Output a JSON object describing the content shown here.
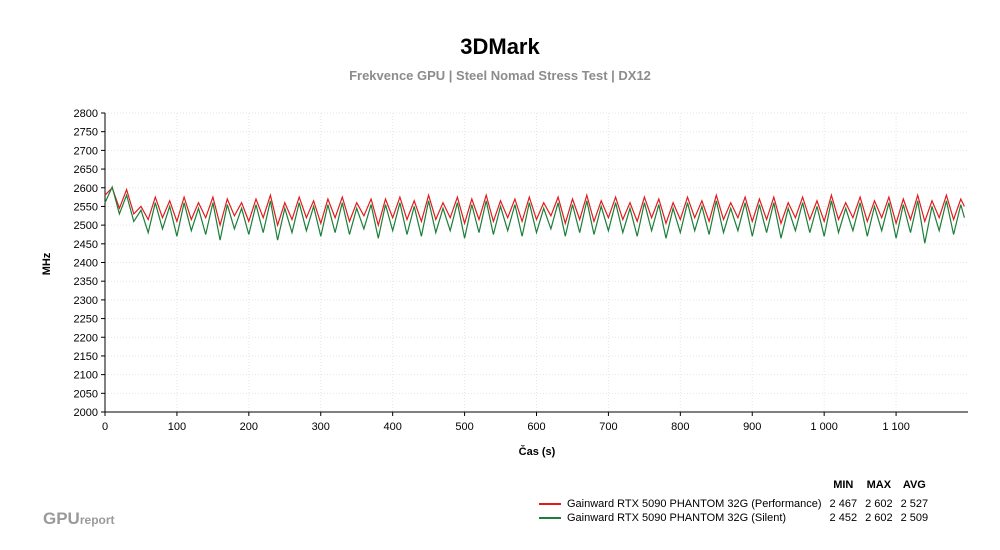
{
  "chart_data": {
    "type": "line",
    "title": "3DMark",
    "subtitle": "Frekvence GPU | Steel Nomad Stress Test | DX12",
    "xlabel": "Čas (s)",
    "ylabel": "MHz",
    "xlim": [
      0,
      1200
    ],
    "ylim": [
      2000,
      2800
    ],
    "x_ticks": [
      0,
      100,
      200,
      300,
      400,
      500,
      600,
      700,
      800,
      900,
      1000,
      1100
    ],
    "x_tick_labels": [
      "0",
      "100",
      "200",
      "300",
      "400",
      "500",
      "600",
      "700",
      "800",
      "900",
      "1 000",
      "1 100"
    ],
    "y_ticks": [
      2000,
      2050,
      2100,
      2150,
      2200,
      2250,
      2300,
      2350,
      2400,
      2450,
      2500,
      2550,
      2600,
      2650,
      2700,
      2750,
      2800
    ],
    "grid": true,
    "legend_headers": [
      "MIN",
      "MAX",
      "AVG"
    ],
    "series": [
      {
        "name": "Gainward RTX 5090 PHANTOM 32G (Performance)",
        "color": "#e31a1c",
        "min": "2 467",
        "max": "2 602",
        "avg": "2 527",
        "x": [
          0,
          10,
          20,
          30,
          40,
          50,
          60,
          70,
          80,
          90,
          100,
          110,
          120,
          130,
          140,
          150,
          160,
          170,
          180,
          190,
          200,
          210,
          220,
          230,
          240,
          250,
          260,
          270,
          280,
          290,
          300,
          310,
          320,
          330,
          340,
          350,
          360,
          370,
          380,
          390,
          400,
          410,
          420,
          430,
          440,
          450,
          460,
          470,
          480,
          490,
          500,
          510,
          520,
          530,
          540,
          550,
          560,
          570,
          580,
          590,
          600,
          610,
          620,
          630,
          640,
          650,
          660,
          670,
          680,
          690,
          700,
          710,
          720,
          730,
          740,
          750,
          760,
          770,
          780,
          790,
          800,
          810,
          820,
          830,
          840,
          850,
          860,
          870,
          880,
          890,
          900,
          910,
          920,
          930,
          940,
          950,
          960,
          970,
          980,
          990,
          1000,
          1010,
          1020,
          1030,
          1040,
          1050,
          1060,
          1070,
          1080,
          1090,
          1100,
          1110,
          1120,
          1130,
          1140,
          1150,
          1160,
          1170,
          1180,
          1190,
          1195
        ],
        "y": [
          2580,
          2600,
          2545,
          2595,
          2530,
          2550,
          2515,
          2575,
          2520,
          2565,
          2510,
          2575,
          2515,
          2560,
          2520,
          2575,
          2500,
          2570,
          2525,
          2560,
          2510,
          2570,
          2520,
          2580,
          2500,
          2560,
          2515,
          2575,
          2520,
          2565,
          2505,
          2570,
          2520,
          2575,
          2510,
          2560,
          2525,
          2570,
          2500,
          2570,
          2520,
          2575,
          2515,
          2565,
          2510,
          2580,
          2515,
          2560,
          2520,
          2575,
          2505,
          2570,
          2515,
          2580,
          2510,
          2565,
          2520,
          2570,
          2510,
          2575,
          2515,
          2560,
          2525,
          2575,
          2505,
          2570,
          2515,
          2580,
          2510,
          2565,
          2520,
          2575,
          2515,
          2560,
          2510,
          2575,
          2520,
          2570,
          2505,
          2560,
          2515,
          2575,
          2520,
          2565,
          2510,
          2580,
          2515,
          2560,
          2520,
          2575,
          2510,
          2570,
          2515,
          2575,
          2505,
          2560,
          2520,
          2575,
          2515,
          2565,
          2510,
          2580,
          2515,
          2560,
          2520,
          2575,
          2510,
          2565,
          2520,
          2575,
          2505,
          2570,
          2515,
          2580,
          2510,
          2565,
          2520,
          2580,
          2515,
          2570,
          2550
        ]
      },
      {
        "name": "Gainward RTX 5090 PHANTOM 32G (Silent)",
        "color": "#1b7f3a",
        "min": "2 452",
        "max": "2 602",
        "avg": "2 509",
        "x": [
          0,
          10,
          20,
          30,
          40,
          50,
          60,
          70,
          80,
          90,
          100,
          110,
          120,
          130,
          140,
          150,
          160,
          170,
          180,
          190,
          200,
          210,
          220,
          230,
          240,
          250,
          260,
          270,
          280,
          290,
          300,
          310,
          320,
          330,
          340,
          350,
          360,
          370,
          380,
          390,
          400,
          410,
          420,
          430,
          440,
          450,
          460,
          470,
          480,
          490,
          500,
          510,
          520,
          530,
          540,
          550,
          560,
          570,
          580,
          590,
          600,
          610,
          620,
          630,
          640,
          650,
          660,
          670,
          680,
          690,
          700,
          710,
          720,
          730,
          740,
          750,
          760,
          770,
          780,
          790,
          800,
          810,
          820,
          830,
          840,
          850,
          860,
          870,
          880,
          890,
          900,
          910,
          920,
          930,
          940,
          950,
          960,
          970,
          980,
          990,
          1000,
          1010,
          1020,
          1030,
          1040,
          1050,
          1060,
          1070,
          1080,
          1090,
          1100,
          1110,
          1120,
          1130,
          1140,
          1150,
          1160,
          1170,
          1180,
          1190,
          1195
        ],
        "y": [
          2560,
          2602,
          2530,
          2580,
          2510,
          2540,
          2480,
          2560,
          2490,
          2550,
          2470,
          2560,
          2485,
          2545,
          2475,
          2560,
          2460,
          2555,
          2490,
          2545,
          2475,
          2555,
          2480,
          2565,
          2460,
          2545,
          2480,
          2560,
          2485,
          2550,
          2470,
          2555,
          2480,
          2560,
          2475,
          2545,
          2490,
          2555,
          2465,
          2555,
          2485,
          2560,
          2475,
          2550,
          2470,
          2565,
          2480,
          2545,
          2485,
          2560,
          2465,
          2555,
          2480,
          2565,
          2475,
          2550,
          2485,
          2555,
          2470,
          2560,
          2480,
          2545,
          2490,
          2560,
          2470,
          2555,
          2480,
          2565,
          2475,
          2550,
          2485,
          2560,
          2480,
          2545,
          2470,
          2560,
          2485,
          2555,
          2465,
          2545,
          2480,
          2560,
          2485,
          2550,
          2475,
          2565,
          2480,
          2545,
          2485,
          2560,
          2470,
          2555,
          2480,
          2560,
          2465,
          2545,
          2485,
          2560,
          2480,
          2550,
          2470,
          2565,
          2480,
          2545,
          2485,
          2560,
          2470,
          2550,
          2485,
          2560,
          2465,
          2555,
          2480,
          2565,
          2452,
          2550,
          2485,
          2565,
          2475,
          2555,
          2520
        ]
      }
    ]
  },
  "branding": {
    "logo_main": "GPU",
    "logo_sub": "report"
  }
}
